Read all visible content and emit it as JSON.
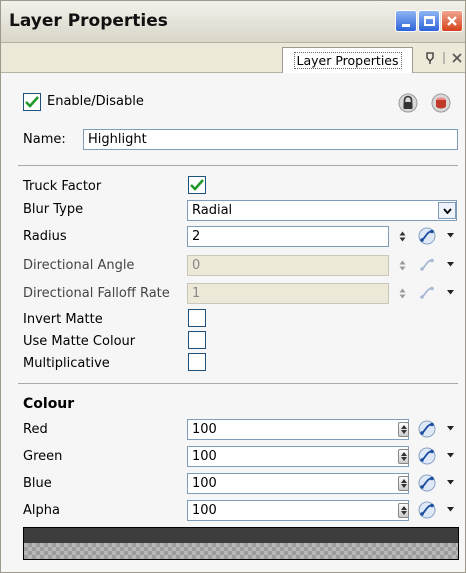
{
  "window": {
    "title": "Layer Properties",
    "tab_label": "Layer Properties"
  },
  "header": {
    "enable_label": "Enable/Disable",
    "enable_checked": true,
    "name_label": "Name:",
    "name_value": "Highlight"
  },
  "props": {
    "truck_factor_label": "Truck Factor",
    "truck_factor_checked": true,
    "blur_type_label": "Blur Type",
    "blur_type_value": "Radial",
    "radius_label": "Radius",
    "radius_value": "2",
    "directional_angle_label": "Directional Angle",
    "directional_angle_value": "0",
    "directional_falloff_label": "Directional Falloff Rate",
    "directional_falloff_value": "1",
    "invert_matte_label": "Invert Matte",
    "invert_matte_checked": false,
    "use_matte_colour_label": "Use Matte Colour",
    "use_matte_colour_checked": false,
    "multiplicative_label": "Multiplicative",
    "multiplicative_checked": false
  },
  "colour": {
    "section_title": "Colour",
    "red_label": "Red",
    "red_value": "100",
    "green_label": "Green",
    "green_value": "100",
    "blue_label": "Blue",
    "blue_value": "100",
    "alpha_label": "Alpha",
    "alpha_value": "100"
  },
  "icons": {
    "check": "checkmark-icon",
    "lock": "lock-icon",
    "layer": "layer-color-icon",
    "function": "function-curve-icon"
  },
  "colors": {
    "check_green": "#1f9a2a",
    "xp_blue": "#2e63d9",
    "xp_close": "#d5421a"
  }
}
